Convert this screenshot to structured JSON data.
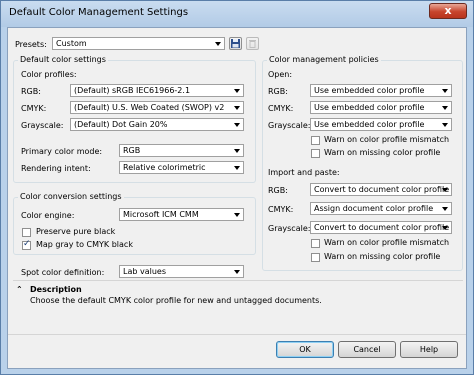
{
  "window": {
    "title": "Default Color Management Settings",
    "close_glyph": "x"
  },
  "presets": {
    "label": "Presets:",
    "value": "Custom"
  },
  "default_color_settings": {
    "title": "Default color settings",
    "color_profiles_label": "Color profiles:",
    "rgb": {
      "label": "RGB:",
      "value": "(Default) sRGB IEC61966-2.1"
    },
    "cmyk": {
      "label": "CMYK:",
      "value": "(Default) U.S. Web Coated (SWOP) v2"
    },
    "grayscale": {
      "label": "Grayscale:",
      "value": "(Default) Dot Gain 20%"
    },
    "primary_color_mode": {
      "label": "Primary color mode:",
      "value": "RGB"
    },
    "rendering_intent": {
      "label": "Rendering intent:",
      "value": "Relative colorimetric"
    }
  },
  "color_conversion": {
    "title": "Color conversion settings",
    "color_engine": {
      "label": "Color engine:",
      "value": "Microsoft ICM CMM"
    },
    "preserve_pure_black": {
      "label": "Preserve pure black",
      "checked": false
    },
    "map_gray_to_cmyk": {
      "label": "Map gray to CMYK black",
      "checked": true
    }
  },
  "spot_color": {
    "label": "Spot color definition:",
    "value": "Lab values"
  },
  "color_management_policies": {
    "title": "Color management policies",
    "open_label": "Open:",
    "open_rgb": {
      "label": "RGB:",
      "value": "Use embedded color profile"
    },
    "open_cmyk": {
      "label": "CMYK:",
      "value": "Use embedded color profile"
    },
    "open_grayscale": {
      "label": "Grayscale:",
      "value": "Use embedded color profile"
    },
    "open_warn_mismatch": {
      "label": "Warn on color profile mismatch",
      "checked": false
    },
    "open_warn_missing": {
      "label": "Warn on missing color profile",
      "checked": false
    },
    "import_label": "Import and paste:",
    "import_rgb": {
      "label": "RGB:",
      "value": "Convert to document color profile"
    },
    "import_cmyk": {
      "label": "CMYK:",
      "value": "Assign document color profile"
    },
    "import_grayscale": {
      "label": "Grayscale:",
      "value": "Convert to document color profile"
    },
    "import_warn_mismatch": {
      "label": "Warn on color profile mismatch",
      "checked": false
    },
    "import_warn_missing": {
      "label": "Warn on missing color profile",
      "checked": false
    }
  },
  "description": {
    "toggle_glyph": "⌃",
    "title": "Description",
    "text": "Choose the default CMYK color profile for new and untagged documents."
  },
  "buttons": {
    "ok": "OK",
    "cancel": "Cancel",
    "help": "Help"
  }
}
